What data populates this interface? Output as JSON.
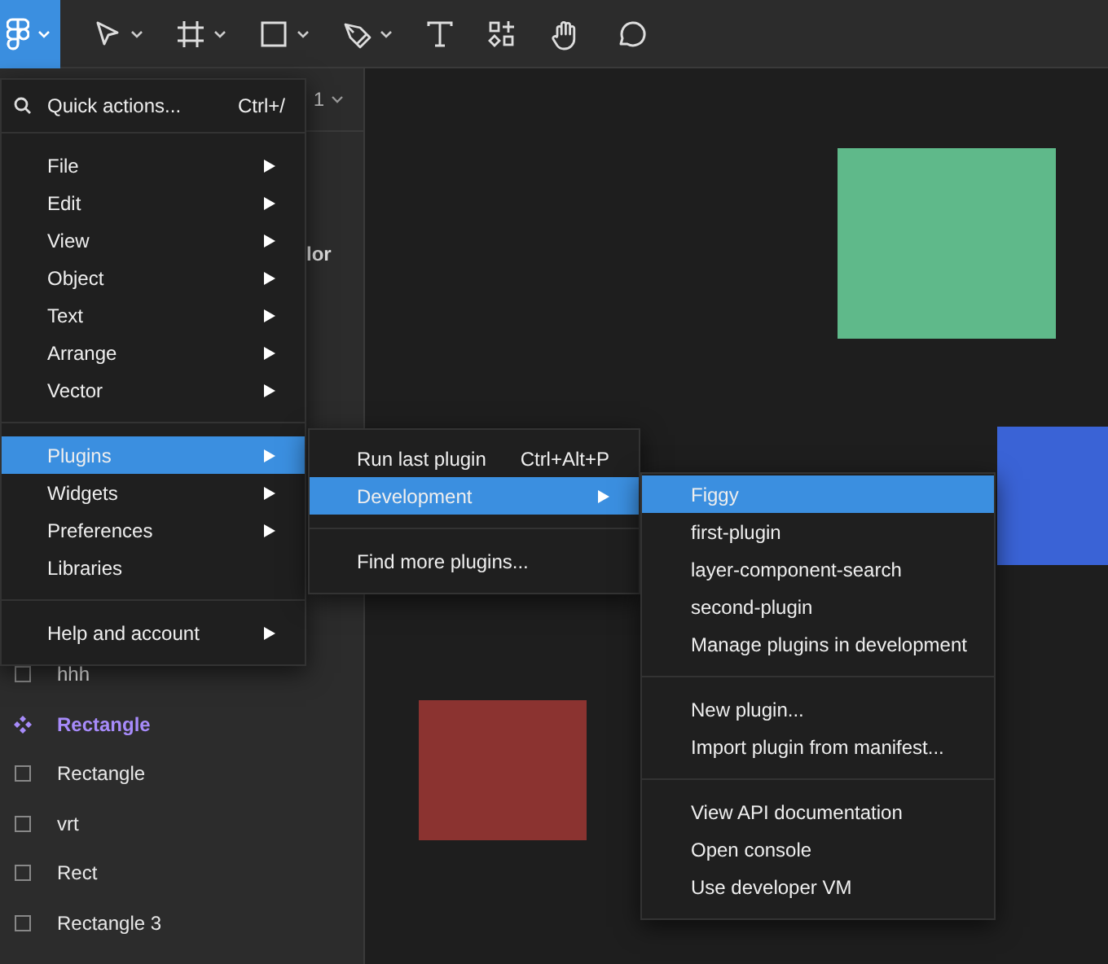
{
  "toolbar": {
    "tools": [
      {
        "kind": "logo",
        "dropdown": true,
        "selected": true
      },
      {
        "kind": "move",
        "dropdown": true,
        "selected": false
      },
      {
        "kind": "frame",
        "dropdown": true,
        "selected": false
      },
      {
        "kind": "shape",
        "dropdown": true,
        "selected": false
      },
      {
        "kind": "pen",
        "dropdown": true,
        "selected": false
      },
      {
        "kind": "text",
        "dropdown": false,
        "selected": false
      },
      {
        "kind": "resources",
        "dropdown": false,
        "selected": false
      },
      {
        "kind": "hand",
        "dropdown": false,
        "selected": false
      },
      {
        "kind": "comment",
        "dropdown": false,
        "selected": false
      }
    ]
  },
  "left_panel": {
    "page_selector": "1",
    "property_fragment": "lor",
    "layers": [
      {
        "name": "hhh",
        "kind": "frame"
      },
      {
        "name": "Rectangle",
        "kind": "component"
      },
      {
        "name": "Rectangle",
        "kind": "frame"
      },
      {
        "name": "vrt",
        "kind": "frame"
      },
      {
        "name": "Rect",
        "kind": "frame"
      },
      {
        "name": "Rectangle 3",
        "kind": "frame"
      }
    ]
  },
  "canvas": {
    "shapes": [
      {
        "color": "#5fb98a"
      },
      {
        "color": "#3a63d6"
      },
      {
        "color": "#8b3330"
      }
    ]
  },
  "main_menu": {
    "quick_actions": {
      "label": "Quick actions...",
      "shortcut": "Ctrl+/"
    },
    "sections": [
      [
        {
          "label": "File",
          "submenu": true,
          "selected": false
        },
        {
          "label": "Edit",
          "submenu": true,
          "selected": false
        },
        {
          "label": "View",
          "submenu": true,
          "selected": false
        },
        {
          "label": "Object",
          "submenu": true,
          "selected": false
        },
        {
          "label": "Text",
          "submenu": true,
          "selected": false
        },
        {
          "label": "Arrange",
          "submenu": true,
          "selected": false
        },
        {
          "label": "Vector",
          "submenu": true,
          "selected": false
        }
      ],
      [
        {
          "label": "Plugins",
          "submenu": true,
          "selected": true
        },
        {
          "label": "Widgets",
          "submenu": true,
          "selected": false
        },
        {
          "label": "Preferences",
          "submenu": true,
          "selected": false
        },
        {
          "label": "Libraries",
          "submenu": false,
          "selected": false
        }
      ],
      [
        {
          "label": "Help and account",
          "submenu": true,
          "selected": false
        }
      ]
    ]
  },
  "plugins_menu": {
    "sections": [
      [
        {
          "label": "Run last plugin",
          "shortcut": "Ctrl+Alt+P",
          "submenu": false,
          "selected": false
        },
        {
          "label": "Development",
          "submenu": true,
          "selected": true
        }
      ],
      [
        {
          "label": "Find more plugins...",
          "submenu": false,
          "selected": false
        }
      ]
    ]
  },
  "development_menu": {
    "sections": [
      [
        {
          "label": "Figgy",
          "selected": true
        },
        {
          "label": "first-plugin",
          "selected": false
        },
        {
          "label": "layer-component-search",
          "selected": false
        },
        {
          "label": "second-plugin",
          "selected": false
        },
        {
          "label": "Manage plugins in development",
          "selected": false
        }
      ],
      [
        {
          "label": "New plugin...",
          "selected": false
        },
        {
          "label": "Import plugin from manifest...",
          "selected": false
        }
      ],
      [
        {
          "label": "View API documentation",
          "selected": false
        },
        {
          "label": "Open console",
          "selected": false
        },
        {
          "label": "Use developer VM",
          "selected": false
        }
      ]
    ]
  }
}
